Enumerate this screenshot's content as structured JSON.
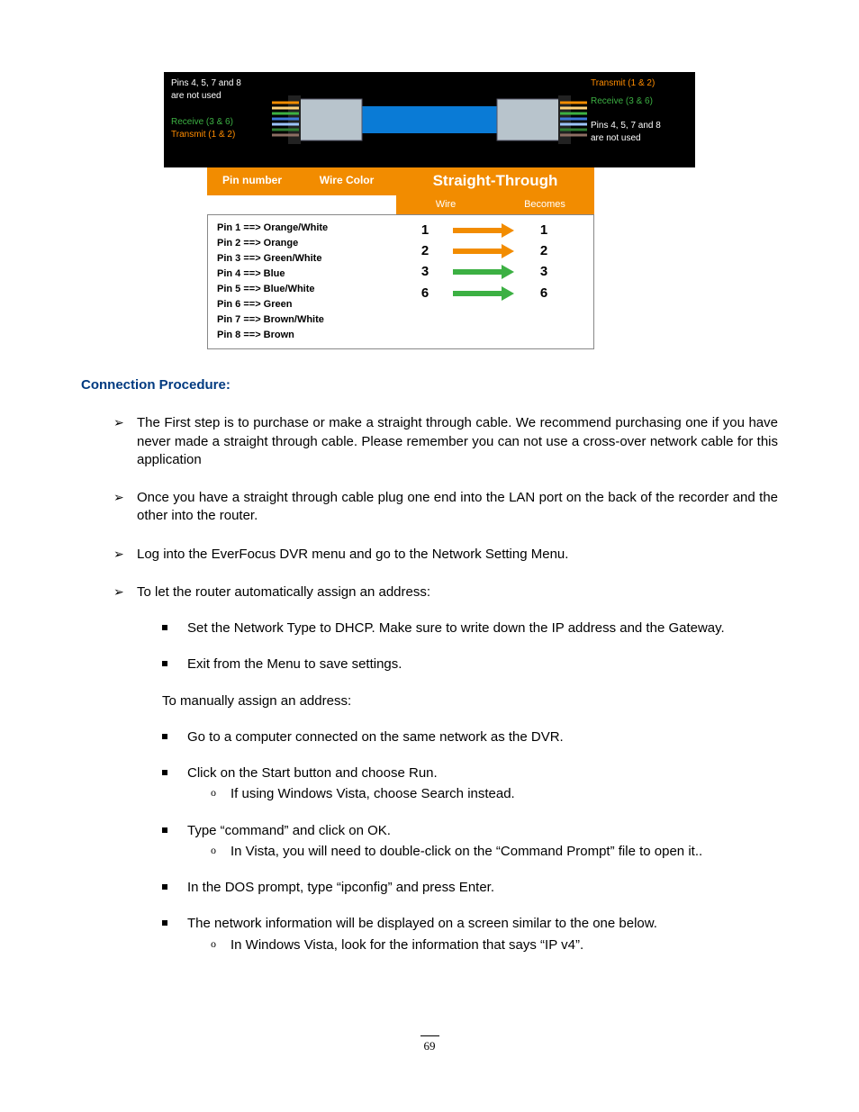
{
  "page_number": "69",
  "diagram": {
    "left_labels": {
      "unused": "Pins 4, 5, 7 and 8\nare not used",
      "receive": "Receive (3 & 6)",
      "transmit": "Transmit (1 & 2)"
    },
    "right_labels": {
      "transmit": "Transmit (1 & 2)",
      "receive": "Receive (3 & 6)",
      "unused": "Pins 4, 5, 7 and 8\nare not used"
    },
    "headers": {
      "pin_number": "Pin number",
      "wire_color": "Wire Color",
      "straight_through": "Straight-Through",
      "wire": "Wire",
      "becomes": "Becomes"
    },
    "pins": [
      "Pin 1 ==> Orange/White",
      "Pin 2 ==> Orange",
      "Pin 3 ==> Green/White",
      "Pin 4 ==> Blue",
      "Pin 5 ==> Blue/White",
      "Pin 6 ==> Green",
      "Pin 7 ==> Brown/White",
      "Pin 8 ==> Brown"
    ],
    "mapping": [
      {
        "from": "1",
        "to": "1",
        "color": "o"
      },
      {
        "from": "2",
        "to": "2",
        "color": "o"
      },
      {
        "from": "3",
        "to": "3",
        "color": "g"
      },
      {
        "from": "6",
        "to": "6",
        "color": "g"
      }
    ]
  },
  "section_title": "Connection Procedure:",
  "bullets": {
    "b1": "The First step is to purchase or make a straight through cable. We recommend purchasing one if you have never made a straight through cable. Please remember you can not use a cross-over network cable for this application",
    "b2": "Once you have a straight through cable plug one end into the LAN port on the back of the recorder and the other into the router.",
    "b3": "Log into the EverFocus DVR menu and go to the Network Setting Menu.",
    "b4": "To let the router automatically assign an address:",
    "b4_sub1": "Set the Network Type to DHCP. Make sure to write down the IP address and the Gateway.",
    "b4_sub2": "Exit from the Menu to save settings.",
    "mid": "To manually assign an address:",
    "s1": "Go to a computer connected on the same network as the DVR.",
    "s2": "Click on the Start button and choose Run.",
    "s2_c1": "If using Windows Vista, choose Search instead.",
    "s3": "Type “command” and click on OK.",
    "s3_c1": "In Vista, you will need to double-click on the “Command Prompt” file to open it..",
    "s4": "In the DOS prompt, type “ipconfig” and press Enter.",
    "s5": "The network information will be displayed on a screen similar to the one below.",
    "s5_c1": "In Windows Vista, look for the information that says “IP v4”."
  }
}
